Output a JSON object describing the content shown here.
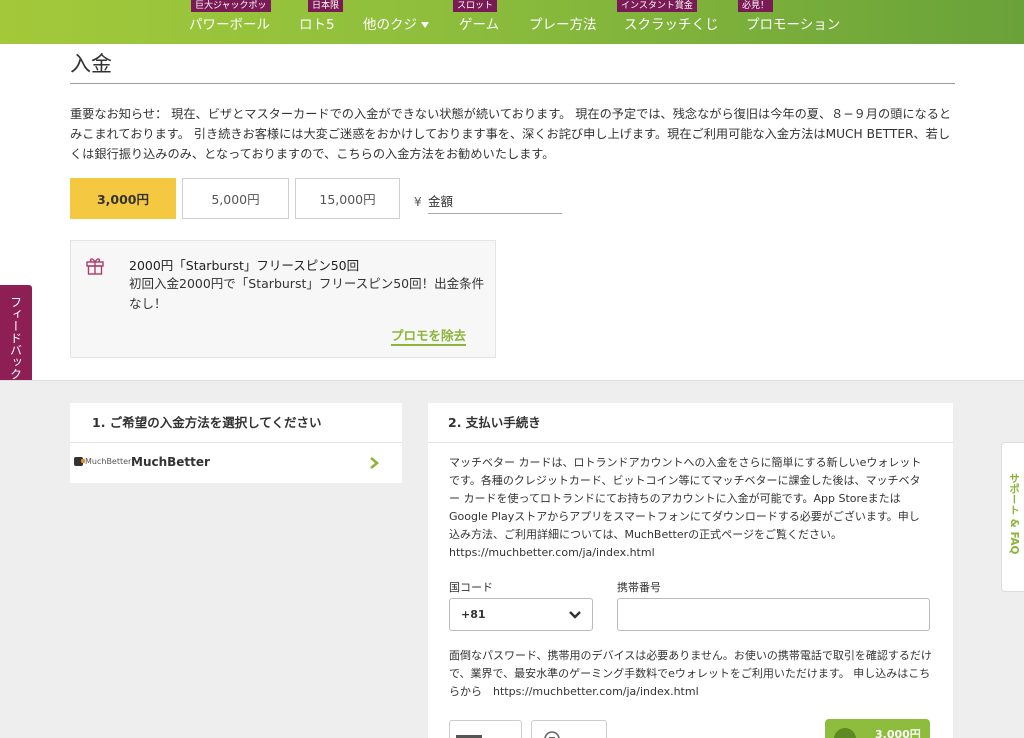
{
  "nav": {
    "items": [
      {
        "label": "パワーボール",
        "badge": "巨大ジャックポッ"
      },
      {
        "label": "ロト5",
        "badge": "日本限"
      },
      {
        "label": "他のクジ",
        "badge": ""
      },
      {
        "label": "ゲーム",
        "badge": "スロット"
      },
      {
        "label": "プレー方法",
        "badge": ""
      },
      {
        "label": "スクラッチくじ",
        "badge": "インスタント賞金"
      },
      {
        "label": "プロモーション",
        "badge": "必見！"
      }
    ]
  },
  "page": {
    "title": "入金",
    "notice": "重要なお知らせ： 現在、ビザとマスターカードでの入金ができない状態が続いております。 現在の予定では、残念ながら復旧は今年の夏、８−９月の頭になるとみこまれております。 引き続きお客様には大変ご迷惑をおかけしております事を、深くお詫び申し上げます。現在ご利用可能な入金方法はMUCH BETTER、若しくは銀行振り込みのみ、となっておりますので、こちらの入金方法をお勧めいたします。"
  },
  "amounts": {
    "options": [
      "3,000円",
      "5,000円",
      "15,000円"
    ],
    "selected_index": 0,
    "currency_symbol": "¥",
    "input_placeholder": "金額"
  },
  "promo": {
    "title": "2000円「Starburst」フリースピン50回",
    "description": "初回入金2000円で「Starburst」フリースピン50回！出金条件なし！",
    "remove_label": "プロモを除去",
    "icon": "gift-icon"
  },
  "feedback_tab": "フィードバック",
  "support_tab": "サポート & FAQ",
  "payment_methods": {
    "heading": "1. ご希望の入金方法を選択してください",
    "items": [
      {
        "logo_text": "MuchBetter",
        "name": "MuchBetter"
      }
    ]
  },
  "payment_procedure": {
    "heading": "2. 支払い手続き",
    "description": "マッチベター カードは、ロトランドアカウントへの入金をさらに簡単にする新しいeウォレットです。各種のクレジットカード、ビットコイン等にてマッチベターに課金した後は、マッチベター カードを使ってロトランドにてお持ちのアカウントに入金が可能です。App StoreまたはGoogle Playストアからアプリをスマートフォンにてダウンロードする必要がございます。申し込み方法、ご利用詳細については、MuchBetterの正式ページをご覧ください。 https://muchbetter.com/ja/index.html",
    "country_code_label": "国コード",
    "country_code_value": "+81",
    "phone_label": "携帯番号",
    "phone_value": "",
    "note": "面倒なパスワード、携帯用のデバイスは必要ありません。お使いの携帯電話で取引を確認するだけで、業界で、最安水準のゲーミング手数料でeウォレットをご利用いただけます。 申し込みはこちらから　https://muchbetter.com/ja/index.html",
    "pay_button_label": "3,000円"
  },
  "colors": {
    "nav_green": "#8fbf3c",
    "badge_purple": "#7a1b55",
    "selected_yellow": "#f5c842",
    "accent_green": "#8db43a",
    "feedback_magenta": "#8e1f55"
  }
}
